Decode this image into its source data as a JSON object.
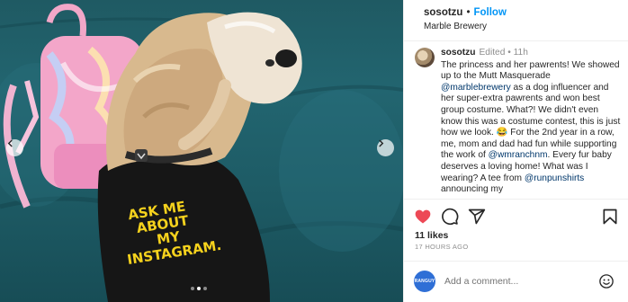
{
  "media": {
    "shirt_text": [
      "ASK ME",
      "ABOUT",
      "MY",
      "INSTAGRAM."
    ],
    "carousel": {
      "slides": 3,
      "current": 2
    },
    "icons": {
      "prev": "chevron-left-icon",
      "next": "chevron-right-icon"
    }
  },
  "post": {
    "username": "sosotzu",
    "separator": "•",
    "follow_label": "Follow",
    "location": "Marble Brewery"
  },
  "caption": {
    "username": "sosotzu",
    "meta": "Edited • 11h",
    "segments": [
      {
        "text": "The princess and her pawrents! We showed up to the Mutt Masquerade ",
        "mention": false
      },
      {
        "text": "@marblebrewery",
        "mention": true
      },
      {
        "text": " as a dog influencer and her super-extra pawrents and won best group costume. What?! We didn't even know this was a costume contest, this is just how we look. 😂 For the 2nd year in a row, me, mom and dad had fun while supporting the work of ",
        "mention": false
      },
      {
        "text": "@wmranchnm",
        "mention": true
      },
      {
        "text": ". Every fur baby deserves a loving home! What was I wearing? A tee from ",
        "mention": false
      },
      {
        "text": "@runpunshirts",
        "mention": true
      },
      {
        "text": " announcing my",
        "mention": false
      }
    ]
  },
  "actions": {
    "icons": [
      "heart-filled-icon",
      "comment-icon",
      "share-icon",
      "bookmark-icon"
    ],
    "liked_color": "#ed4956"
  },
  "stats": {
    "likes": "11 likes",
    "timestamp": "17 HOURS AGO"
  },
  "add_comment": {
    "avatar_text": "RANGUY",
    "placeholder": "Add a comment...",
    "emoji_icon": "smiley-icon"
  },
  "colors": {
    "accent": "#0095f6",
    "mention": "#00376b",
    "muted": "#8e8e8e",
    "couch": "#226570"
  }
}
